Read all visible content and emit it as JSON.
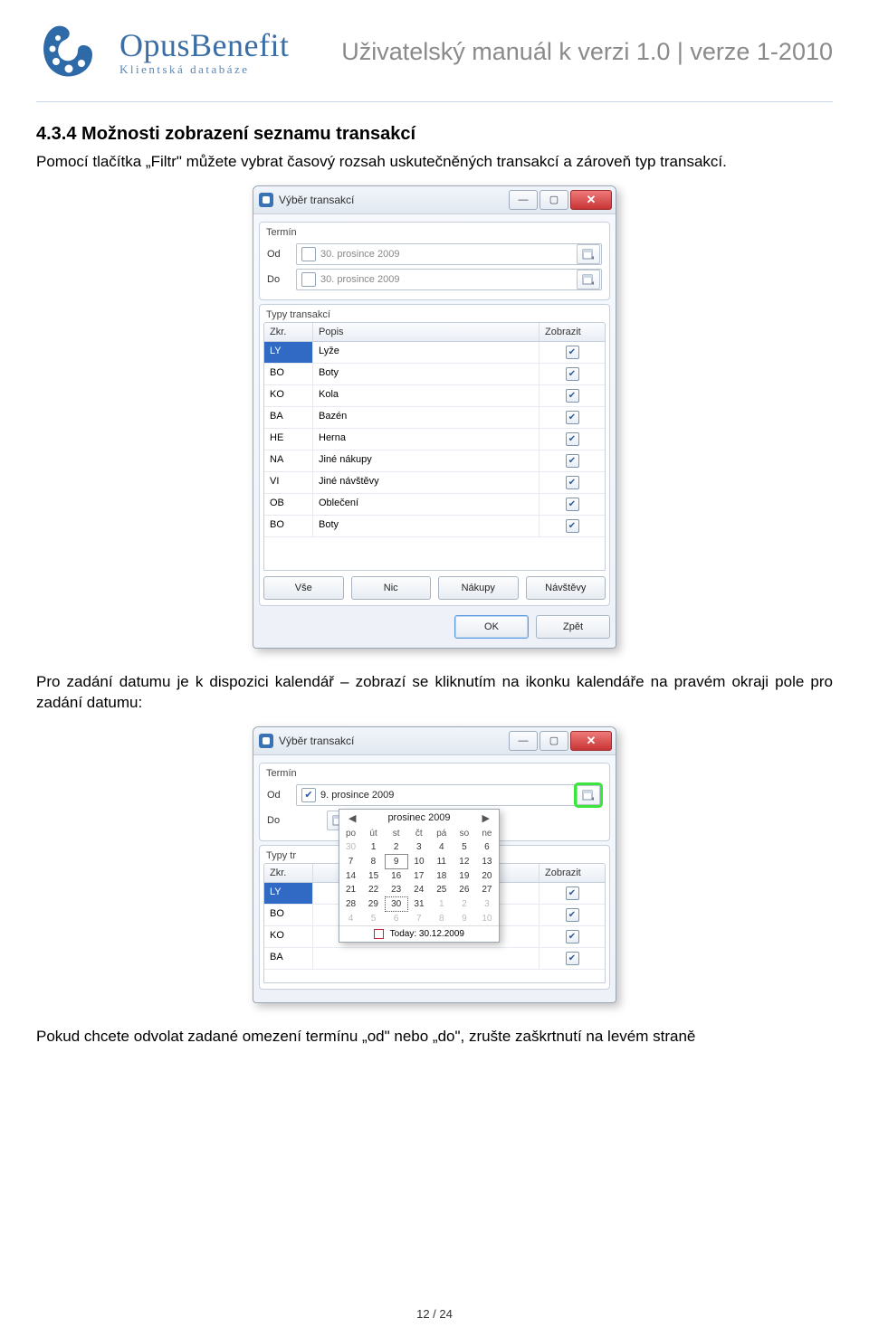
{
  "header": {
    "brand": "OpusBenefit",
    "sub": "Klientská databáze",
    "title": "Uživatelský manuál k verzi 1.0 | verze 1-2010"
  },
  "section": {
    "heading": "4.3.4 Možnosti zobrazení seznamu transakcí",
    "p1": "Pomocí tlačítka „Filtr\" můžete vybrat časový rozsah uskutečněných transakcí a zároveň typ transakcí.",
    "p2": "Pro zadání datumu je k dispozici kalendář – zobrazí se kliknutím na ikonku kalendáře na pravém okraji pole pro zadání datumu:",
    "p3": "Pokud chcete odvolat zadané omezení termínu „od\" nebo „do\", zrušte zaškrtnutí na levém straně"
  },
  "win1": {
    "title": "Výběr transakcí",
    "group_termin": "Termín",
    "lbl_od": "Od",
    "lbl_do": "Do",
    "date_od": "30. prosince 2009",
    "date_do": "30. prosince 2009",
    "group_typy": "Typy transakcí",
    "col_zkr": "Zkr.",
    "col_popis": "Popis",
    "col_zobrazit": "Zobrazit",
    "rows": [
      {
        "zkr": "LY",
        "popis": "Lyže"
      },
      {
        "zkr": "BO",
        "popis": "Boty"
      },
      {
        "zkr": "KO",
        "popis": "Kola"
      },
      {
        "zkr": "BA",
        "popis": "Bazén"
      },
      {
        "zkr": "HE",
        "popis": "Herna"
      },
      {
        "zkr": "NA",
        "popis": "Jiné nákupy"
      },
      {
        "zkr": "VI",
        "popis": "Jiné návštěvy"
      },
      {
        "zkr": "OB",
        "popis": "Oblečení"
      },
      {
        "zkr": "BO",
        "popis": "Boty"
      }
    ],
    "btn_vse": "Vše",
    "btn_nic": "Nic",
    "btn_nakupy": "Nákupy",
    "btn_navstevy": "Návštěvy",
    "btn_ok": "OK",
    "btn_zpet": "Zpět"
  },
  "win2": {
    "title": "Výběr transakcí",
    "group_termin": "Termín",
    "lbl_od": "Od",
    "lbl_do": "Do",
    "date_od": "9. prosince 2009",
    "group_typy": "Typy tr",
    "col_zkr": "Zkr.",
    "col_zobrazit": "Zobrazit",
    "rows": [
      {
        "zkr": "LY"
      },
      {
        "zkr": "BO"
      },
      {
        "zkr": "KO"
      },
      {
        "zkr": "BA"
      }
    ],
    "cal": {
      "month": "prosinec 2009",
      "dow": [
        "po",
        "út",
        "st",
        "čt",
        "pá",
        "so",
        "ne"
      ],
      "grid": [
        [
          "30",
          "1",
          "2",
          "3",
          "4",
          "5",
          "6"
        ],
        [
          "7",
          "8",
          "9",
          "10",
          "11",
          "12",
          "13"
        ],
        [
          "14",
          "15",
          "16",
          "17",
          "18",
          "19",
          "20"
        ],
        [
          "21",
          "22",
          "23",
          "24",
          "25",
          "26",
          "27"
        ],
        [
          "28",
          "29",
          "30",
          "31",
          "1",
          "2",
          "3"
        ],
        [
          "4",
          "5",
          "6",
          "7",
          "8",
          "9",
          "10"
        ]
      ],
      "today_label": "Today: 30.12.2009"
    }
  },
  "footer": "12 / 24"
}
